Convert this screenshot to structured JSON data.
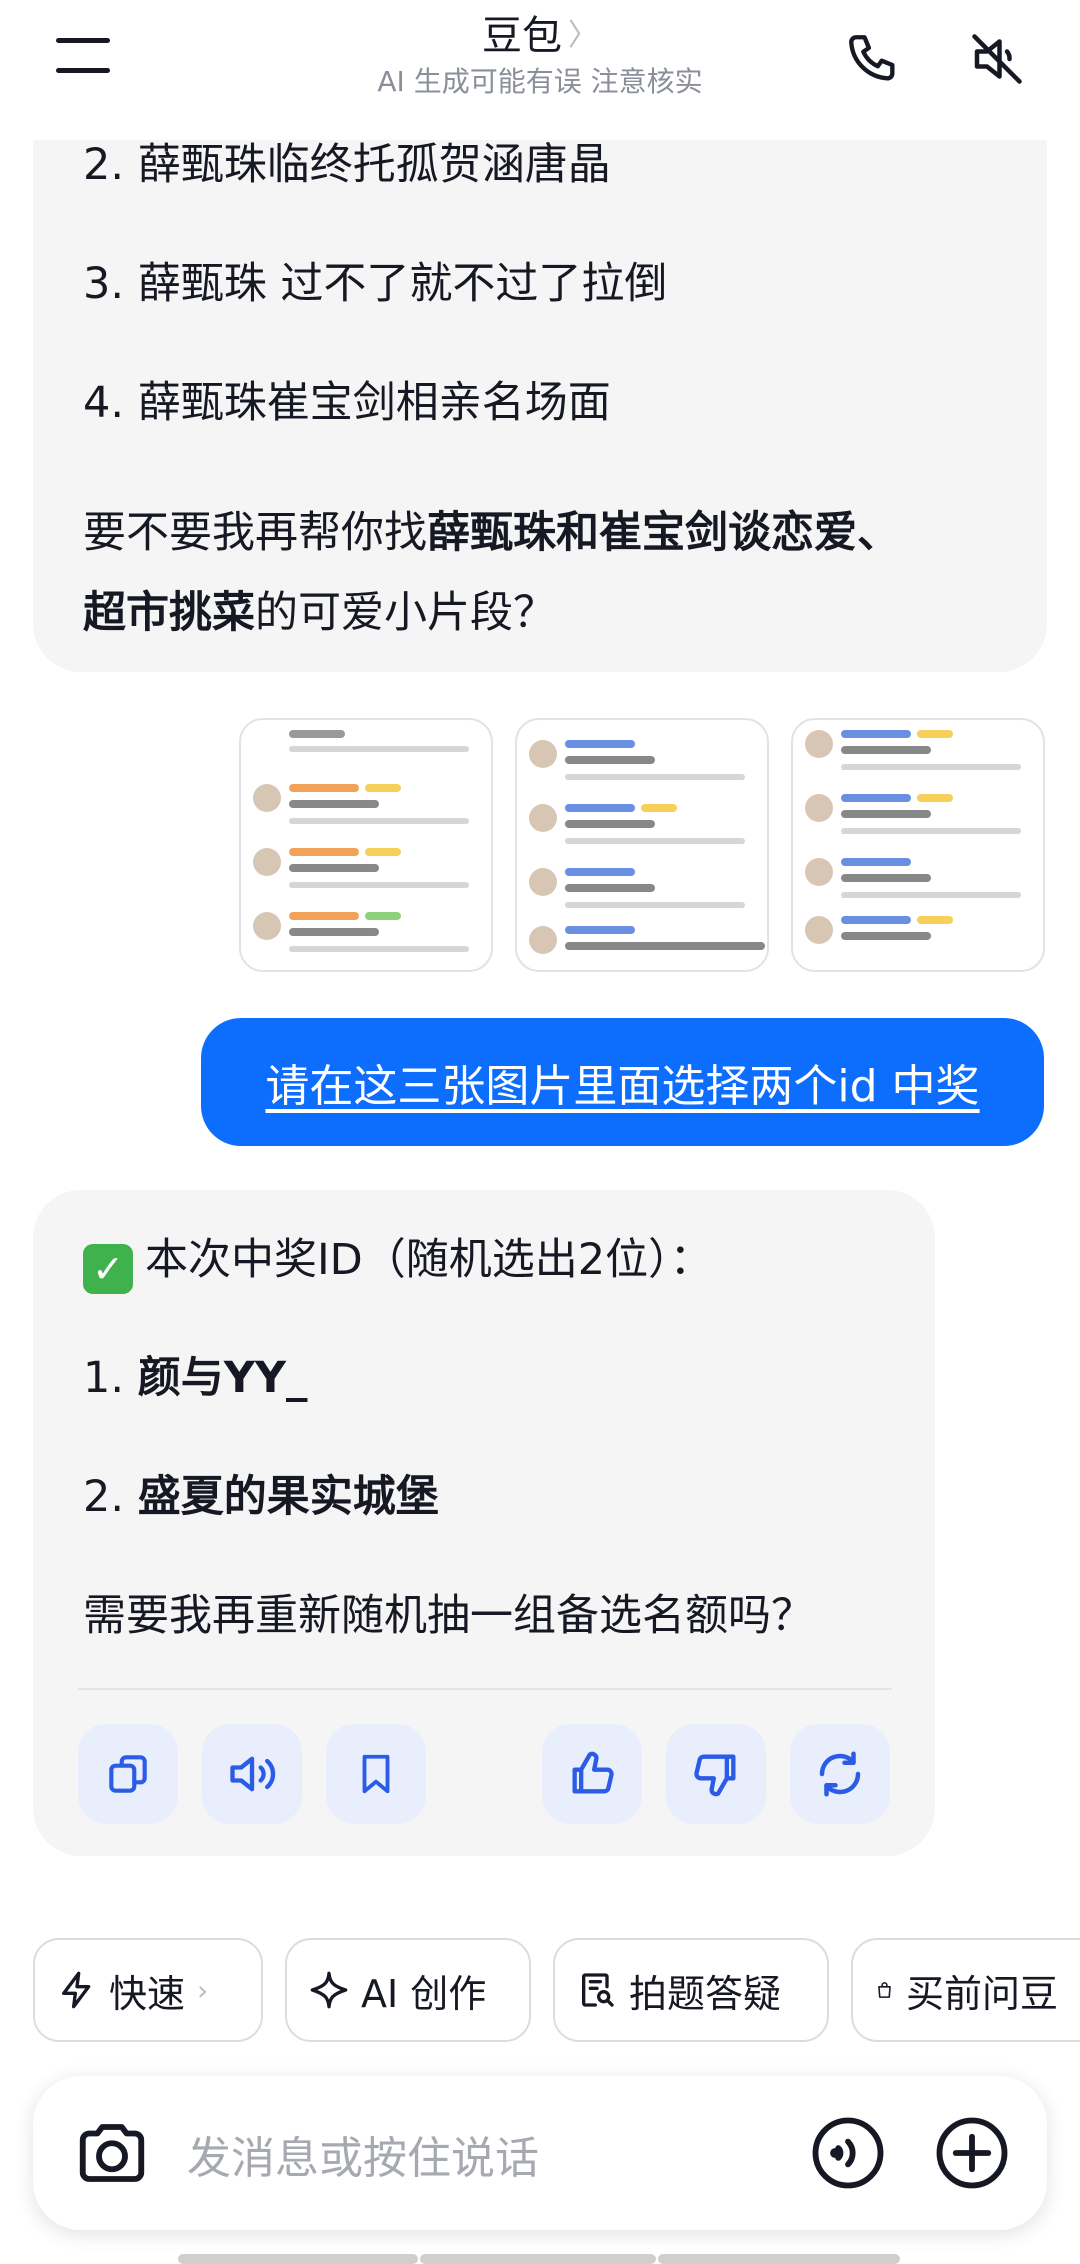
{
  "header": {
    "title": "豆包",
    "title_chevron": "〉",
    "subtitle": "AI 生成可能有误 注意核实"
  },
  "messages": [
    {
      "role": "assistant",
      "lines": [
        "2. 薛甄珠临终托孤贺涵唐晶",
        "3. 薛甄珠 过不了就不过了拉倒",
        "4. 薛甄珠崔宝剑相亲名场面"
      ],
      "closing_prefix": "要不要我再帮你找",
      "closing_bold_1": "薛甄珠和崔宝剑谈恋爱、",
      "closing_bold_2": "超市挑菜",
      "closing_suffix": "的可爱小片段？"
    },
    {
      "role": "user",
      "text": "请在这三张图片里面选择两个id 中奖",
      "images": [
        "screenshot-1",
        "screenshot-2",
        "screenshot-3"
      ]
    },
    {
      "role": "assistant",
      "heading": "本次中奖ID（随机选出2位）：",
      "winner_1_index": "1.",
      "winner_1": "颜与YY_",
      "winner_2_index": "2.",
      "winner_2": "盛夏的果实城堡",
      "question": "需要我再重新随机抽一组备选名额吗？"
    }
  ],
  "actions": [
    "copy-icon",
    "speaker-icon",
    "bookmark-icon",
    "thumbs-up-icon",
    "thumbs-down-icon",
    "refresh-icon"
  ],
  "chips": [
    {
      "label": "快速",
      "icon": "lightning-icon",
      "chevron": "›"
    },
    {
      "label": "AI 创作",
      "icon": "sparkle-icon"
    },
    {
      "label": "拍题答疑",
      "icon": "scan-question-icon"
    },
    {
      "label": "买前问豆",
      "icon": "shopping-bag-icon"
    }
  ],
  "input": {
    "placeholder": "发消息或按住说话"
  },
  "colors": {
    "accent": "#0d6efd",
    "bubble_bg": "#f5f5f5",
    "action_bg": "#e8eefb",
    "icon_blue": "#2b5ce6"
  }
}
